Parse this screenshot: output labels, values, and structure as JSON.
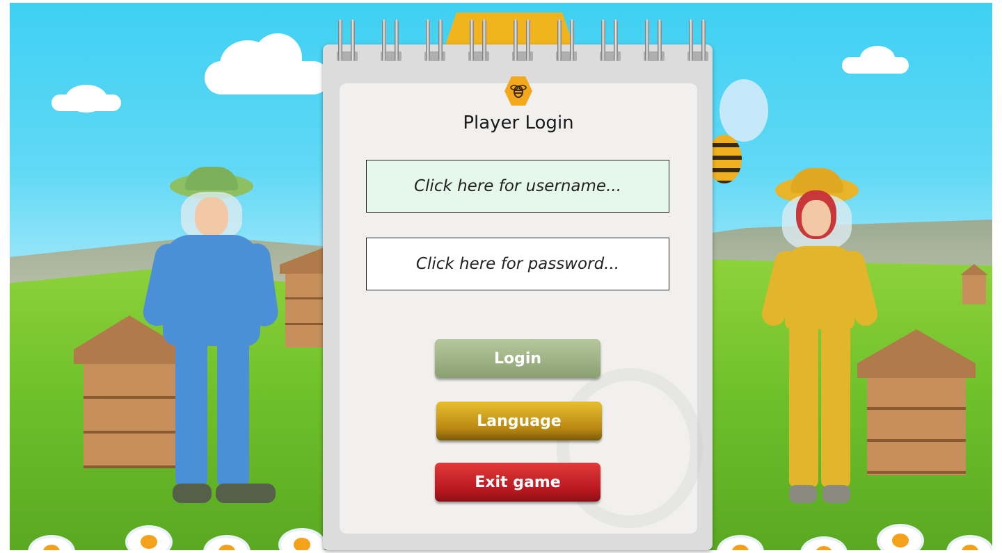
{
  "dialog": {
    "title": "Player Login",
    "logo_icon": "bee-icon"
  },
  "form": {
    "username_placeholder": "Click here for username...",
    "password_placeholder": "Click here for password..."
  },
  "buttons": {
    "login": "Login",
    "language": "Language",
    "exit": "Exit game"
  },
  "colors": {
    "login": "#9db285",
    "language": "#d4a51d",
    "exit": "#c8202a",
    "username_field": "#e6f8ea",
    "password_field": "#ffffff"
  }
}
